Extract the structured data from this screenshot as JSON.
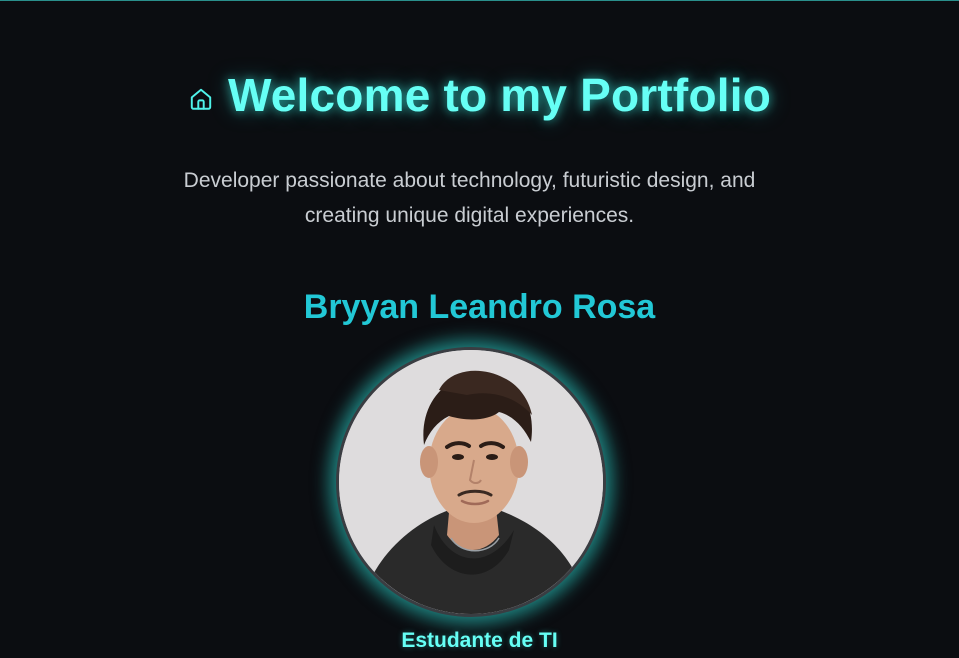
{
  "hero": {
    "title": "Welcome to my Portfolio",
    "icon": "home-icon",
    "subtitle": "Developer passionate about technology, futuristic design, and creating unique digital experiences."
  },
  "profile": {
    "name": "Bryyan Leandro Rosa",
    "role": "Estudante de TI",
    "photo_alt": "Bryyan Leandro Rosa"
  },
  "colors": {
    "background": "#0b0d11",
    "accent": "#66fff5",
    "name": "#22c8d6",
    "text": "#c9cdd2"
  }
}
